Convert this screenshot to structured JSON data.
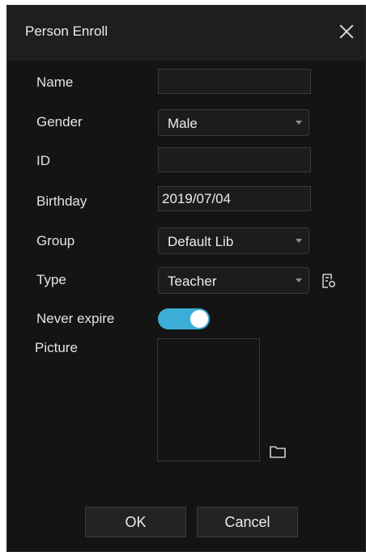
{
  "dialog": {
    "title": "Person Enroll"
  },
  "form": {
    "name_label": "Name",
    "name_value": "",
    "gender_label": "Gender",
    "gender_value": "Male",
    "id_label": "ID",
    "id_value": "",
    "birthday_label": "Birthday",
    "birthday_value": "2019/07/04",
    "group_label": "Group",
    "group_value": "Default Lib",
    "type_label": "Type",
    "type_value": "Teacher",
    "never_expire_label": "Never expire",
    "never_expire_on": true,
    "picture_label": "Picture"
  },
  "buttons": {
    "ok_label": "OK",
    "cancel_label": "Cancel"
  },
  "colors": {
    "background": "#141414",
    "toggle_on": "#3aaed6",
    "text": "#e4e4e4"
  },
  "icons": {
    "close": "close-icon",
    "type_manage": "type-manage-icon",
    "folder": "folder-icon",
    "dropdown": "chevron-down-icon"
  }
}
